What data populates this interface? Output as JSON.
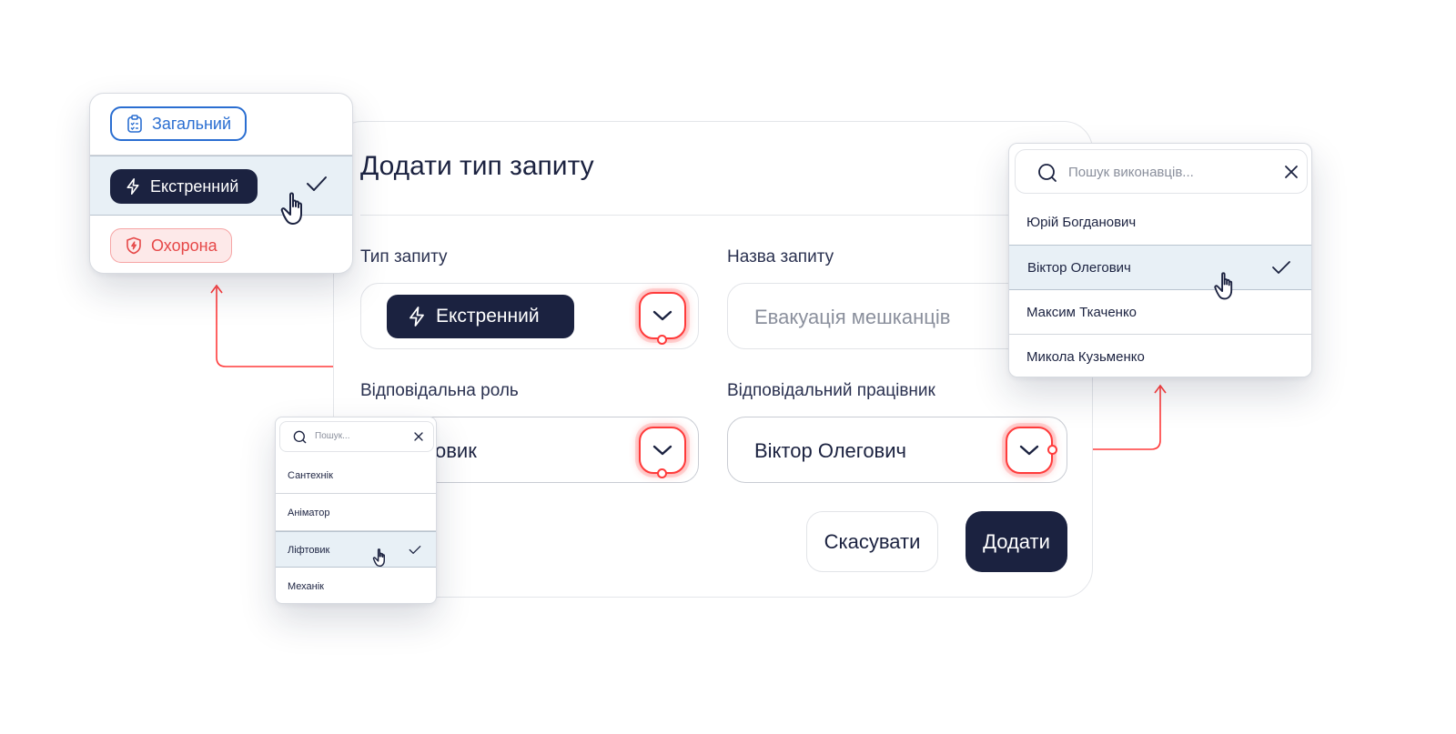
{
  "modal": {
    "title": "Додати тип запиту",
    "type_label": "Тип запиту",
    "type_value": "Екстренний",
    "name_label": "Назва запиту",
    "name_placeholder": "Евакуація мешканців",
    "role_label": "Відповідальна роль",
    "role_value_partial": "овик",
    "worker_label": "Відповідальний працівник",
    "worker_value": "Віктор Олегович",
    "cancel_label": "Скасувати",
    "add_label": "Додати"
  },
  "type_popover": {
    "items": [
      {
        "label": "Загальний",
        "style": "blue-outline",
        "icon": "clipboard-icon"
      },
      {
        "label": "Екстренний",
        "style": "dark",
        "icon": "lightning-icon",
        "selected": true
      },
      {
        "label": "Охорона",
        "style": "red",
        "icon": "shield-icon"
      }
    ]
  },
  "worker_popover": {
    "search_placeholder": "Пошук виконавців...",
    "items": [
      {
        "label": "Юрій Богданович"
      },
      {
        "label": "Віктор Олегович",
        "selected": true
      },
      {
        "label": "Максим Ткаченко"
      },
      {
        "label": "Микола Кузьменко"
      }
    ]
  },
  "role_popover": {
    "search_placeholder": "Пошук...",
    "items": [
      {
        "label": "Сантехнік"
      },
      {
        "label": "Аніматор"
      },
      {
        "label": "Ліфтовик",
        "selected": true
      },
      {
        "label": "Механік"
      }
    ]
  },
  "colors": {
    "navy": "#1b2240",
    "accent_red": "#ff3b3b",
    "accent_blue": "#2a6ed1",
    "selected_row": "#e8f0f6"
  }
}
